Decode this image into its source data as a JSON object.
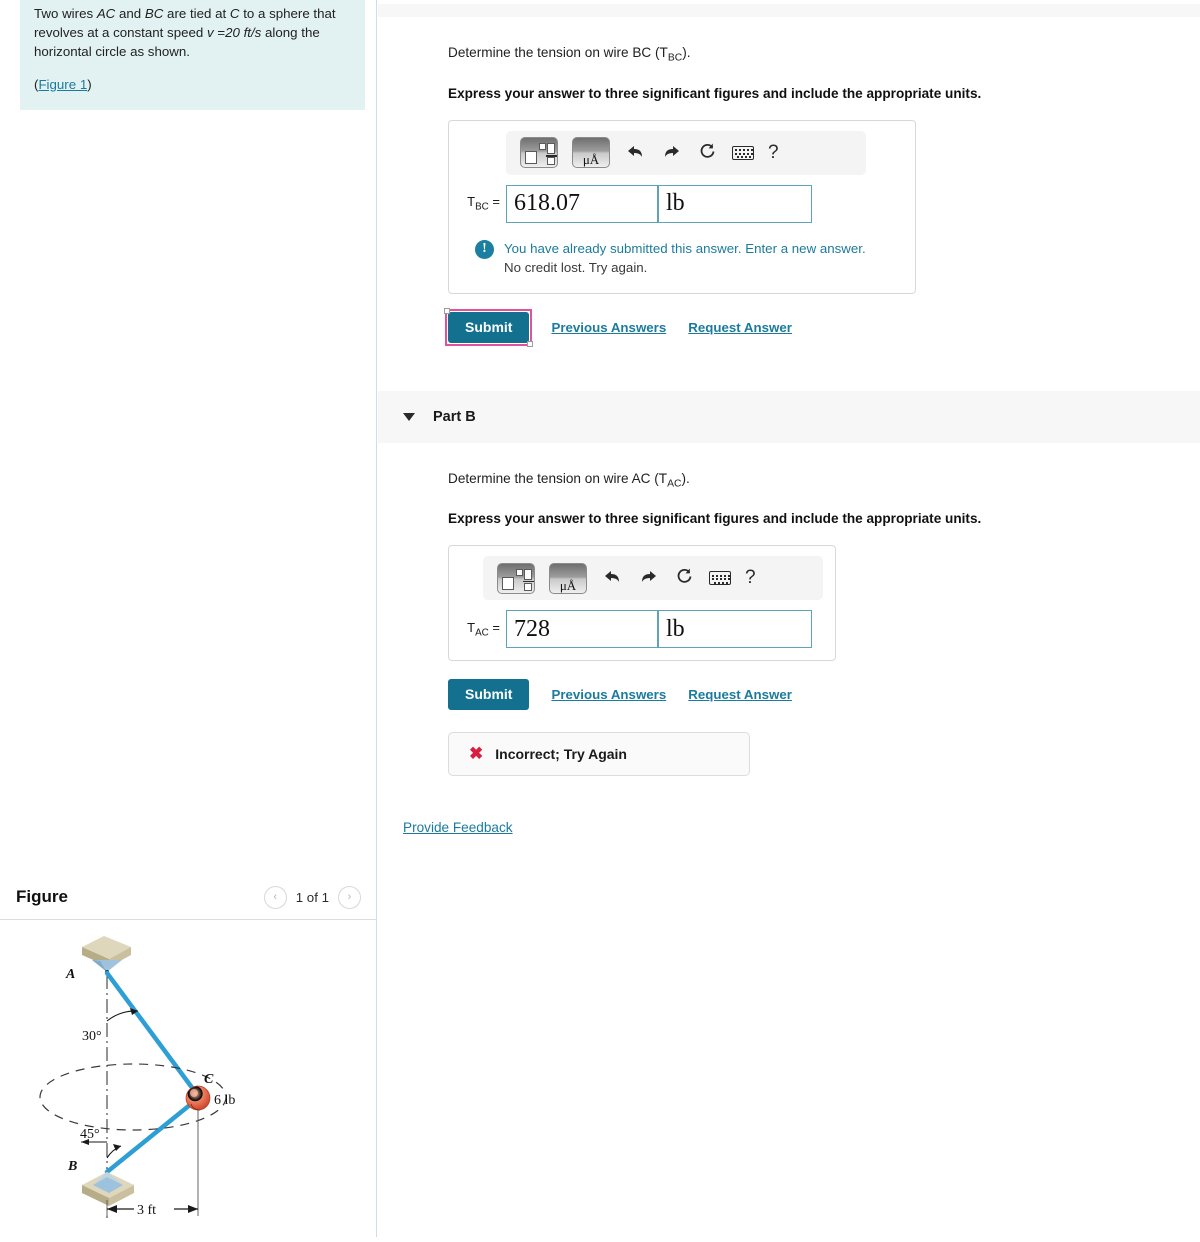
{
  "problem": {
    "text_part1": "Two wires ",
    "wire1": "AC",
    "text_part2": " and ",
    "wire2": "BC",
    "text_part3": " are tied at ",
    "point_c": "C",
    "text_part4": " to a sphere that revolves at a constant speed ",
    "speed_var": "v",
    "speed_eq": " =",
    "speed_val": "20",
    "speed_units": "ft/s",
    "text_part5": " along the horizontal circle as shown.",
    "figure_link_open": "(",
    "figure_link": "Figure 1",
    "figure_link_close": ")"
  },
  "part_a": {
    "question_pre": "Determine the tension on wire BC (T",
    "question_sub": "BC",
    "question_post": ").",
    "instruction": "Express your answer to three significant figures and include the appropriate units.",
    "symbol_pre": "T",
    "symbol_sub": "BC",
    "symbol_post": " =",
    "value": "618.07",
    "units": "lb",
    "notice_line1": "You have already submitted this answer. Enter a new answer.",
    "notice_line2": "No credit lost. Try again.",
    "notice_icon_glyph": "!",
    "submit_label": "Submit",
    "previous_answers_label": "Previous Answers",
    "request_answer_label": "Request Answer"
  },
  "part_b": {
    "header_label": "Part B",
    "question_pre": "Determine the tension on wire AC (T",
    "question_sub": "AC",
    "question_post": ").",
    "instruction": "Express your answer to three significant figures and include the appropriate units.",
    "symbol_pre": "T",
    "symbol_sub": "AC",
    "symbol_post": " =",
    "value": "728",
    "units": "lb",
    "submit_label": "Submit",
    "previous_answers_label": "Previous Answers",
    "request_answer_label": "Request Answer",
    "result_mark": "✖",
    "result_text": "Incorrect; Try Again"
  },
  "toolbar": {
    "math_template_name": "math-template-icon",
    "units_label": "μÅ",
    "units_mu": "μ",
    "units_angstrom": "Å",
    "undo_glyph": "⮜",
    "redo_glyph": "⮞",
    "reset_glyph": "↻",
    "help_glyph": "?"
  },
  "feedback": {
    "label": "Provide Feedback"
  },
  "figure_panel": {
    "title": "Figure",
    "prev_glyph": "‹",
    "next_glyph": "›",
    "count": "1 of 1"
  },
  "diagram": {
    "label_a": "A",
    "label_b": "B",
    "label_c": "C",
    "angle_top": "30°",
    "angle_bottom": "45°",
    "weight": "6 lb",
    "distance": "3 ft",
    "colors": {
      "wire": "#2e9fd4",
      "block": "#cfc6a4",
      "block_top": "#ddd6b9",
      "cone": "#8fb8d6",
      "sphere": "#ef6a45"
    }
  },
  "colors": {
    "accent_teal": "#13718f",
    "link_blue": "#1b7b9e",
    "selection_pink": "#e0529c",
    "error_red": "#d81f3f",
    "problem_bg": "#e2f2f2",
    "band_gray": "#f7f7f7"
  }
}
